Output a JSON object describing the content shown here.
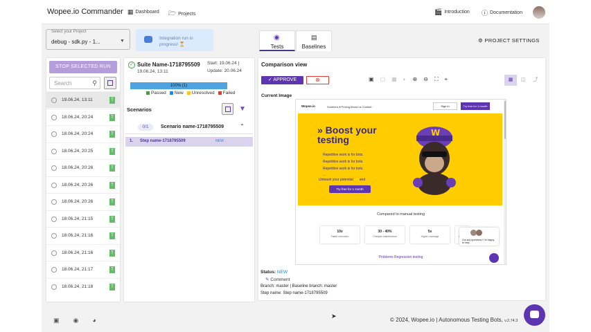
{
  "header": {
    "brand": "Wopee.io Commander",
    "nav": [
      {
        "label": "Dashboard",
        "icon": "grid-icon"
      },
      {
        "label": "Projects",
        "icon": "folder-icon"
      }
    ],
    "right_links": [
      {
        "label": "Introduction",
        "icon": "clapperboard-icon"
      },
      {
        "label": "Documentation",
        "icon": "help-circle-icon"
      }
    ]
  },
  "project": {
    "label": "Select your Project",
    "value": "debug - sdk.py - 1...",
    "integration_text": "Integration run in progress! ⏳"
  },
  "tabs": [
    {
      "label": "Tests",
      "icon": "robot-icon",
      "active": true
    },
    {
      "label": "Baselines",
      "icon": "library-icon",
      "active": false
    }
  ],
  "project_settings": "PROJECT SETTINGS",
  "left": {
    "stop_label": "STOP SELECTED RUN",
    "search_placeholder": "Search",
    "runs": [
      {
        "date": "19.06.24, 13:11",
        "badge": "T",
        "active": true
      },
      {
        "date": "18.06.24, 20:24",
        "badge": "T"
      },
      {
        "date": "18.06.24, 20:24",
        "badge": "T"
      },
      {
        "date": "18.06.24, 20:25",
        "badge": "T"
      },
      {
        "date": "18.06.24, 20:26",
        "badge": "T"
      },
      {
        "date": "18.06.24, 20:26",
        "badge": "T"
      },
      {
        "date": "18.06.24, 20:26",
        "badge": "T"
      },
      {
        "date": "18.06.24, 21:15",
        "badge": "T"
      },
      {
        "date": "18.06.24, 21:16",
        "badge": "T"
      },
      {
        "date": "18.06.24, 21:16",
        "badge": "T"
      },
      {
        "date": "18.06.24, 21:17",
        "badge": "T"
      },
      {
        "date": "18.06.24, 21:18",
        "badge": "T"
      }
    ]
  },
  "suite": {
    "name": "Suite Name-1718795509",
    "date": "19.06.24, 13:11",
    "start": "Start: 19.06.24 |",
    "update": "Update: 20.06.24",
    "progress_label": "100% (1)",
    "progress": 1.0,
    "legend": [
      {
        "label": "Passed",
        "color": "#43a047"
      },
      {
        "label": "New",
        "color": "#1e88e5"
      },
      {
        "label": "Unresolved",
        "color": "#fbc02d"
      },
      {
        "label": "Failed",
        "color": "#e53935"
      }
    ]
  },
  "scenarios": {
    "title": "Scenarios",
    "count": "0/1",
    "name": "Scenario name-1718795509",
    "step_num": "1.",
    "step_name": "Step name-1718795509",
    "step_badge": "NEW"
  },
  "comparison": {
    "title": "Comparison view",
    "approve": "APPROVE",
    "current_image": "Current Image",
    "status_label": "Status:",
    "status_value": "NEW",
    "comment": "Comment",
    "branch": "Branch: master | Baseline branch: master",
    "step_name": "Step name: Step name-1718795509"
  },
  "preview": {
    "logo": "Wopee.io",
    "links": "Solutions ▾    Pricing    About us    Contact",
    "signin": "Sign in",
    "try": "Try free for 1 month",
    "headline": "» Boost your testing",
    "lines": [
      "Repetitive work is for bots.",
      "Repetitive work is for bots.",
      "Repetitive work is for bots.",
      "...",
      "Unleash your potential ✨ and"
    ],
    "cta": "Try free for 1 month",
    "compare": "Compared to manual testing",
    "cards": [
      {
        "big": "10x",
        "small": "Faster execution"
      },
      {
        "big": "30 - 40%",
        "small": "Cheaper maintenance"
      },
      {
        "big": "5x",
        "small": "Higher coverage"
      },
      {
        "big": "50",
        "small": "Fewer"
      }
    ],
    "chat": "Got any questions? I'm happy to help.",
    "regression": "Problems Regression testing"
  },
  "footer": {
    "text": "© 2024, Wopee.io | Autonomous Testing Bots,",
    "version": "v.2.74.3"
  }
}
